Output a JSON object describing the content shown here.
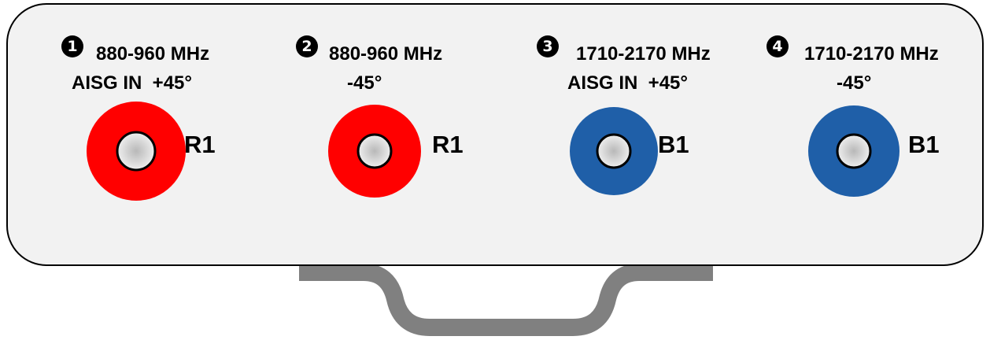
{
  "colors": {
    "panel_fill": "#f2f2f2",
    "panel_stroke": "#000000",
    "handle": "#808080",
    "low_band_ring": "#ff0000",
    "high_band_ring": "#1f5fa8",
    "connector_center": "#d9d9d9"
  },
  "ports": [
    {
      "number": "1",
      "band": "880-960 MHz",
      "sub": "AISG IN  +45°",
      "connector_label": "R1",
      "ring_color": "low_band_ring"
    },
    {
      "number": "2",
      "band": "880-960 MHz",
      "sub": "-45°",
      "connector_label": "R1",
      "ring_color": "low_band_ring"
    },
    {
      "number": "3",
      "band": "1710-2170 MHz",
      "sub": "AISG IN  +45°",
      "connector_label": "B1",
      "ring_color": "high_band_ring"
    },
    {
      "number": "4",
      "band": "1710-2170 MHz",
      "sub": "-45°",
      "connector_label": "B1",
      "ring_color": "high_band_ring"
    }
  ]
}
